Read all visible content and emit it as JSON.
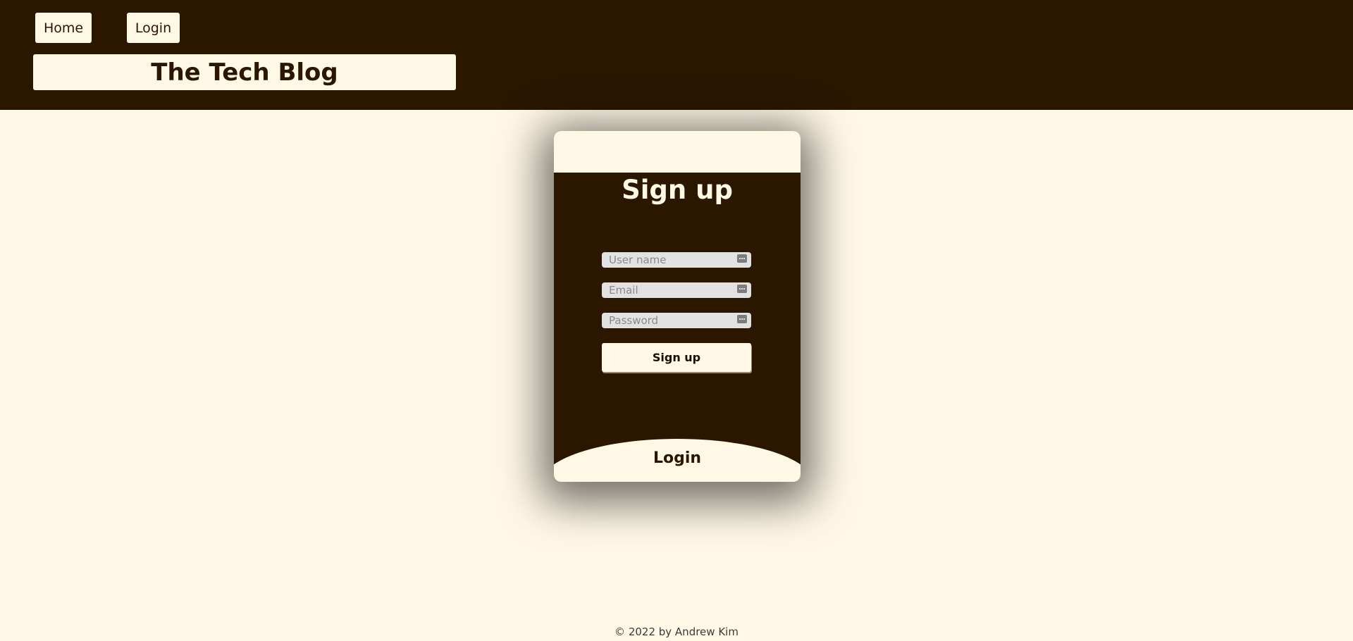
{
  "nav": {
    "home_label": "Home",
    "login_label": "Login"
  },
  "header": {
    "title": "The Tech Blog"
  },
  "signup_card": {
    "heading": "Sign up",
    "username_placeholder": "User name",
    "email_placeholder": "Email",
    "password_placeholder": "Password",
    "submit_label": "Sign up",
    "login_link_label": "Login"
  },
  "footer": {
    "text": "© 2022 by Andrew Kim"
  },
  "colors": {
    "primary_dark": "#2b1700",
    "cream": "#fff8e6",
    "input_bg": "#e3e2e3"
  }
}
